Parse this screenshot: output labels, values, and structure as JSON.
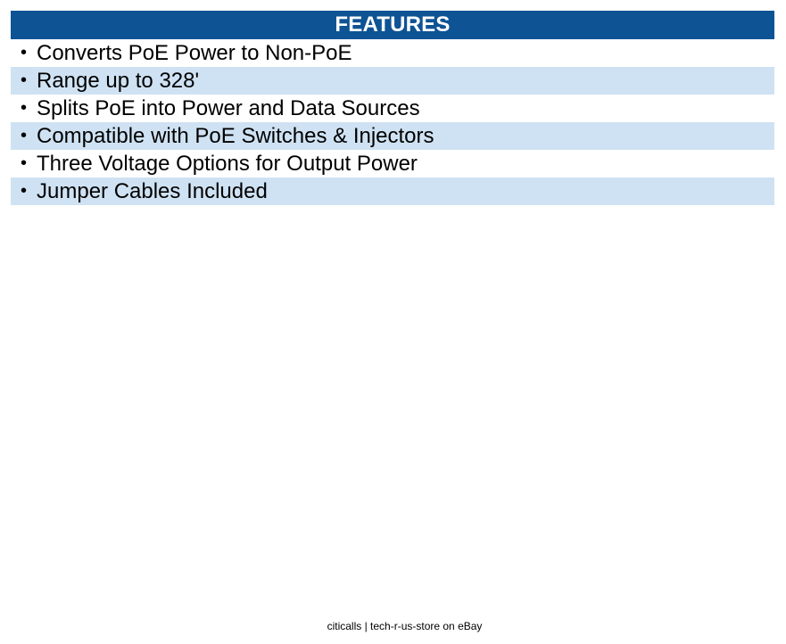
{
  "features": {
    "title": "FEATURES",
    "bullet": "•",
    "items": [
      "Converts PoE Power to Non-PoE",
      "Range up to 328'",
      "Splits PoE into Power and Data Sources",
      "Compatible with PoE Switches & Injectors",
      "Three Voltage Options for Output Power",
      "Jumper Cables Included"
    ]
  },
  "footer": {
    "text": "citicalls | tech-r-us-store on eBay"
  },
  "colors": {
    "header_background": "#0e5394",
    "header_text": "#ffffff",
    "alternate_row_background": "#cfe2f3"
  }
}
